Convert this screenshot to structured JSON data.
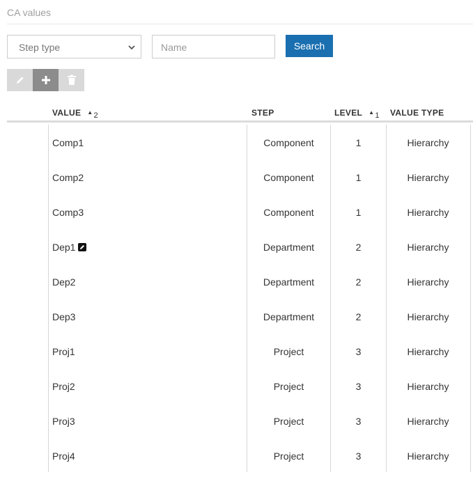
{
  "page": {
    "title": "CA values"
  },
  "filters": {
    "step_type_selected": "Step type",
    "name_placeholder": "Name",
    "search_label": "Search"
  },
  "toolbar": {
    "buttons": [
      "pencil-icon",
      "plus-icon",
      "trash-icon"
    ]
  },
  "table": {
    "columns": [
      {
        "label": "VALUE",
        "sort": "ascending",
        "sort_rank": "2"
      },
      {
        "label": "STEP"
      },
      {
        "label": "LEVEL",
        "sort": "ascending",
        "sort_rank": "1"
      },
      {
        "label": "VALUE TYPE"
      }
    ],
    "rows": [
      {
        "value": "Comp1",
        "step": "Component",
        "level": "1",
        "value_type": "Hierarchy"
      },
      {
        "value": "Comp2",
        "step": "Component",
        "level": "1",
        "value_type": "Hierarchy"
      },
      {
        "value": "Comp3",
        "step": "Component",
        "level": "1",
        "value_type": "Hierarchy"
      },
      {
        "value": "Dep1",
        "step": "Department",
        "level": "2",
        "value_type": "Hierarchy",
        "icon": "edit-note-icon"
      },
      {
        "value": "Dep2",
        "step": "Department",
        "level": "2",
        "value_type": "Hierarchy"
      },
      {
        "value": "Dep3",
        "step": "Department",
        "level": "2",
        "value_type": "Hierarchy"
      },
      {
        "value": "Proj1",
        "step": "Project",
        "level": "3",
        "value_type": "Hierarchy"
      },
      {
        "value": "Proj2",
        "step": "Project",
        "level": "3",
        "value_type": "Hierarchy"
      },
      {
        "value": "Proj3",
        "step": "Project",
        "level": "3",
        "value_type": "Hierarchy"
      },
      {
        "value": "Proj4",
        "step": "Project",
        "level": "3",
        "value_type": "Hierarchy"
      }
    ]
  },
  "colors": {
    "accent": "#1a6fb0",
    "toolbar_disabled": "#d9d9d9",
    "toolbar_active": "#8c8c8c"
  }
}
